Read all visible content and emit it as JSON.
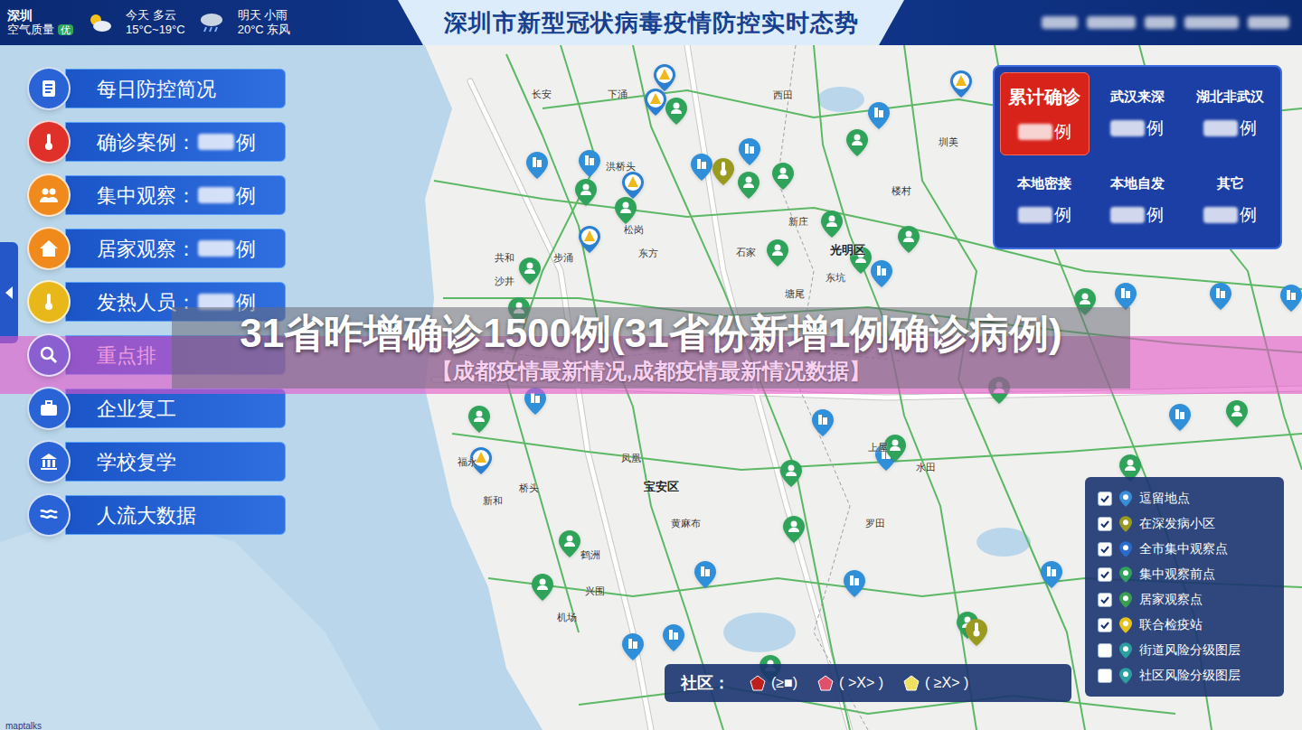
{
  "header": {
    "city": "深圳",
    "air_label": "空气质量",
    "air_quality": "优",
    "today": {
      "label": "今天 多云",
      "temp": "15°C~19°C"
    },
    "tomorrow": {
      "label": "明天 小雨",
      "temp": "20°C 东风"
    },
    "title": "深圳市新型冠状病毒疫情防控实时态势"
  },
  "menu": [
    {
      "label": "每日防控简况",
      "kind": "link",
      "color": "#2a63d6"
    },
    {
      "label": "确诊案例：",
      "unit": "例",
      "kind": "count",
      "color": "#e0302a"
    },
    {
      "label": "集中观察：",
      "unit": "例",
      "kind": "count",
      "color": "#f08a1c"
    },
    {
      "label": "居家观察：",
      "unit": "例",
      "kind": "count",
      "color": "#f08a1c"
    },
    {
      "label": "发热人员：",
      "unit": "例",
      "kind": "count",
      "color": "#e8b81a"
    },
    {
      "label": "重点排",
      "kind": "link",
      "color": "#8a5fd0"
    },
    {
      "label": "企业复工",
      "kind": "link",
      "color": "#2a63d6"
    },
    {
      "label": "学校复学",
      "kind": "link",
      "color": "#2a63d6"
    },
    {
      "label": "人流大数据",
      "kind": "link",
      "color": "#2a63d6"
    }
  ],
  "stats": [
    {
      "label": "累计确诊",
      "unit": "例",
      "selected": true
    },
    {
      "label": "武汉来深",
      "unit": "例",
      "selected": false
    },
    {
      "label": "湖北非武汉",
      "unit": "例",
      "selected": false
    },
    {
      "label": "本地密接",
      "unit": "例",
      "selected": false
    },
    {
      "label": "本地自发",
      "unit": "例",
      "selected": false
    },
    {
      "label": "其它",
      "unit": "例",
      "selected": false
    }
  ],
  "layers": [
    {
      "label": "逗留地点",
      "checked": true,
      "color": "#3a8ed8"
    },
    {
      "label": "在深发病小区",
      "checked": true,
      "color": "#9a9a20"
    },
    {
      "label": "全市集中观察点",
      "checked": true,
      "color": "#2a6bd0"
    },
    {
      "label": "集中观察前点",
      "checked": true,
      "color": "#2fa35a"
    },
    {
      "label": "居家观察点",
      "checked": true,
      "color": "#3aa050"
    },
    {
      "label": "联合检疫站",
      "checked": true,
      "color": "#e8c21a"
    },
    {
      "label": "街道风险分级图层",
      "checked": false,
      "color": "#2aa0a0"
    },
    {
      "label": "社区风险分级图层",
      "checked": false,
      "color": "#2aa0a0"
    }
  ],
  "community_legend": {
    "label": "社区：",
    "items": [
      {
        "text": "(≥■)",
        "color": "#c0201c"
      },
      {
        "text": "( >X> )",
        "color": "#e0506a"
      },
      {
        "text": "( ≥X> )",
        "color": "#f0e060"
      }
    ]
  },
  "banner": {
    "title": "31省昨增确诊1500例(31省份新增1例确诊病例)",
    "subtitle": "【成都疫情最新情况,成都疫情最新情况数据】"
  },
  "map": {
    "attribution": "maptalks",
    "labels": [
      "下涌",
      "洪桥头",
      "松岗",
      "东方",
      "共和",
      "步涌",
      "沙井",
      "新庄",
      "石家",
      "光明区",
      "东坑",
      "塘尾",
      "圳美",
      "楼村",
      "凤凰",
      "宝安区",
      "黄麻布",
      "水田",
      "福永",
      "新和",
      "桥头",
      "鹤洲",
      "兴围",
      "机场",
      "罗田",
      "上屋",
      "西田",
      "长安"
    ],
    "pins": [
      {
        "kind": "stay"
      },
      {
        "kind": "stay"
      },
      {
        "kind": "stay"
      },
      {
        "kind": "stay"
      },
      {
        "kind": "stay"
      },
      {
        "kind": "stay"
      },
      {
        "kind": "stay"
      },
      {
        "kind": "stay"
      },
      {
        "kind": "stay"
      },
      {
        "kind": "stay"
      },
      {
        "kind": "stay"
      },
      {
        "kind": "stay"
      },
      {
        "kind": "stay"
      },
      {
        "kind": "stay"
      },
      {
        "kind": "stay"
      },
      {
        "kind": "stay"
      },
      {
        "kind": "stay"
      },
      {
        "kind": "stay"
      },
      {
        "kind": "observe"
      },
      {
        "kind": "observe"
      },
      {
        "kind": "observe"
      },
      {
        "kind": "observe"
      },
      {
        "kind": "observe"
      },
      {
        "kind": "observe"
      },
      {
        "kind": "observe"
      },
      {
        "kind": "observe"
      },
      {
        "kind": "observe"
      },
      {
        "kind": "observe"
      },
      {
        "kind": "observe"
      },
      {
        "kind": "observe"
      },
      {
        "kind": "observe"
      },
      {
        "kind": "observe"
      },
      {
        "kind": "observe"
      },
      {
        "kind": "observe"
      },
      {
        "kind": "observe"
      },
      {
        "kind": "observe"
      },
      {
        "kind": "observe"
      },
      {
        "kind": "observe"
      },
      {
        "kind": "observe"
      },
      {
        "kind": "observe"
      },
      {
        "kind": "observe"
      },
      {
        "kind": "observe"
      },
      {
        "kind": "station"
      },
      {
        "kind": "station"
      },
      {
        "kind": "station"
      },
      {
        "kind": "station"
      },
      {
        "kind": "station"
      },
      {
        "kind": "station"
      },
      {
        "kind": "fever"
      },
      {
        "kind": "fever"
      }
    ]
  }
}
